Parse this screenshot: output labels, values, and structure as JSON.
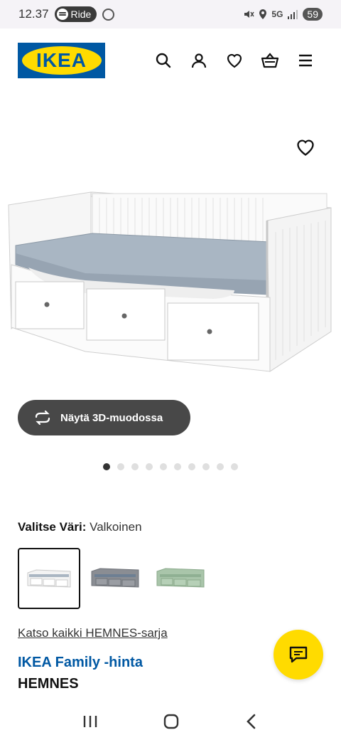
{
  "status": {
    "time": "12.37",
    "ride_label": "Ride",
    "network": "5G",
    "battery": "59"
  },
  "header": {
    "logo_text": "IKEA"
  },
  "product": {
    "view_3d_label": "Näytä 3D-muodossa",
    "gallery_count": 10,
    "gallery_active_index": 0,
    "color_label": "Valitse Väri:",
    "color_value": "Valkoinen",
    "swatches": [
      {
        "color": "white",
        "selected": true
      },
      {
        "color": "grey",
        "selected": false
      },
      {
        "color": "green",
        "selected": false
      }
    ],
    "series_link": "Katso kaikki HEMNES-sarja",
    "family_price_label": "IKEA Family -hinta",
    "name": "HEMNES"
  },
  "colors": {
    "ikea_blue": "#0058a3",
    "ikea_yellow": "#ffdb00",
    "button_dark": "#484848"
  }
}
